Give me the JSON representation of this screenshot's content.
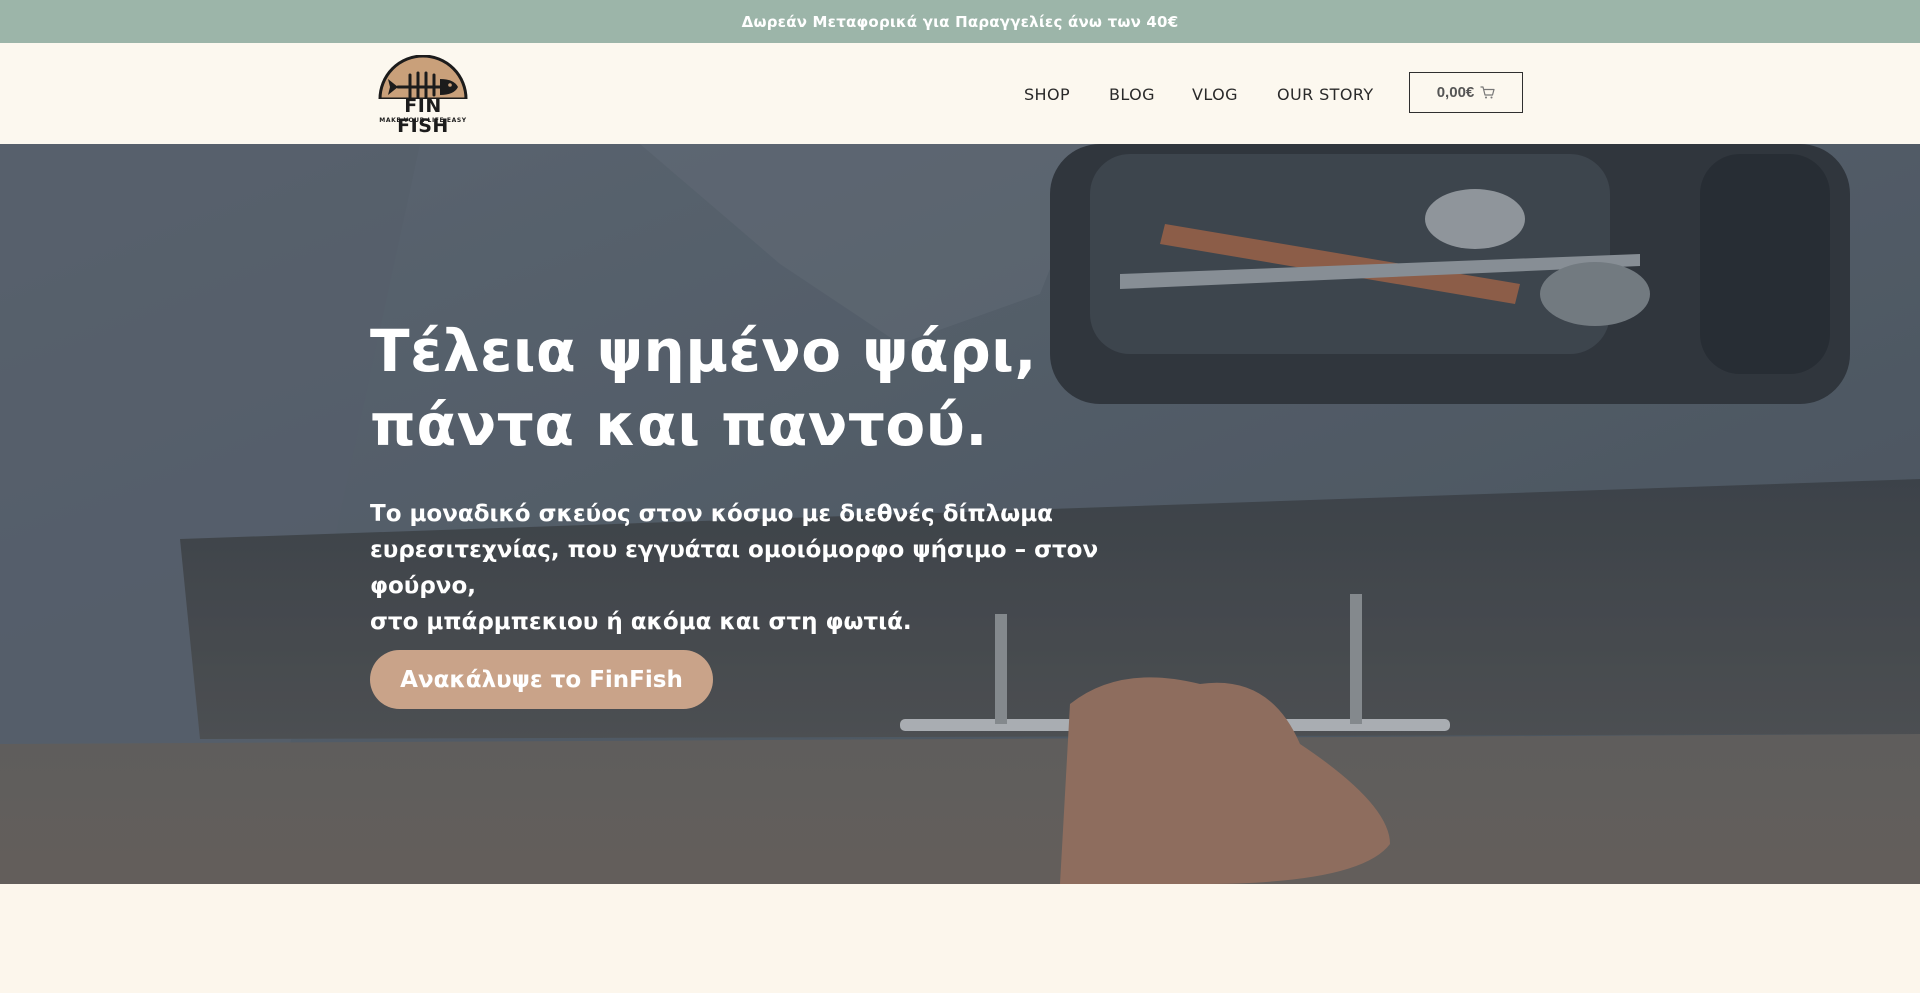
{
  "announcement": {
    "text": "Δωρεάν Μεταφορικά για Παραγγελίες άνω των 40€"
  },
  "logo": {
    "name": "FIN FISH",
    "tagline": "MAKE YOUR LIFE EASY",
    "icon": "fish-skeleton-icon"
  },
  "nav": {
    "items": [
      {
        "label": "SHOP"
      },
      {
        "label": "BLOG"
      },
      {
        "label": "VLOG"
      },
      {
        "label": "OUR STORY"
      }
    ]
  },
  "cart": {
    "total": "0,00€",
    "icon": "cart-icon"
  },
  "hero": {
    "title_line1": "Τέλεια ψημένο ψάρι,",
    "title_line2": "πάντα και παντού.",
    "subtitle_line1": "Το μοναδικό σκεύος στον κόσμο με διεθνές δίπλωμα",
    "subtitle_line2": "ευρεσιτεχνίας, που εγγυάται ομοιόμορφο ψήσιμο – στον φούρνο,",
    "subtitle_line3": "στο μπάρμπεκιου ή ακόμα και στη φωτιά.",
    "cta_label": "Ανακάλυψε το FinFish"
  },
  "colors": {
    "announcement_bg": "#9cb5a9",
    "page_bg": "#fcf6ec",
    "cta_bg": "#c9a389",
    "logo_accent": "#c9a07a"
  }
}
